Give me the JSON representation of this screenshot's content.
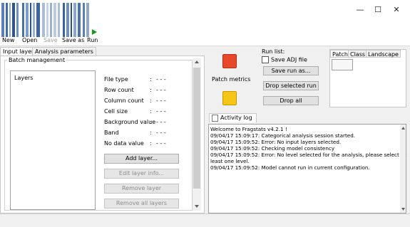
{
  "window": {
    "minimize": "—",
    "maximize": "☐",
    "close": "✕"
  },
  "toolbar": {
    "new_label": "New",
    "open_label": "Open",
    "save_label": "Save",
    "save_as_label": "Save as",
    "run_label": "Run"
  },
  "left_tabs": {
    "input_layers": "Input layers",
    "analysis_parameters": "Analysis parameters"
  },
  "batch": {
    "title": "Batch management",
    "layers_label": "Layers",
    "props": [
      {
        "label": "File type",
        "value": "- - -"
      },
      {
        "label": "Row count",
        "value": "- - -"
      },
      {
        "label": "Column count",
        "value": "- - -"
      },
      {
        "label": "Cell size",
        "value": "- - -"
      },
      {
        "label": "Background value",
        "value": "- - -"
      },
      {
        "label": "Band",
        "value": "- - -"
      },
      {
        "label": "No data value",
        "value": "- - -"
      }
    ],
    "colon": ":",
    "add_layer": "Add layer...",
    "edit_layer_info": "Edit layer info...",
    "remove_layer": "Remove layer",
    "remove_all_layers": "Remove all layers"
  },
  "metrics": {
    "patch_metrics": "Patch metrics"
  },
  "run_list": {
    "title": "Run list:",
    "save_adj": "Save ADJ file",
    "save_run_as": "Save run as...",
    "drop_selected_run": "Drop selected run",
    "drop_all": "Drop all"
  },
  "runs_tabs": {
    "patch": "Patch",
    "class": "Class",
    "landscape": "Landscape"
  },
  "log": {
    "tab_label": "Activity log",
    "lines": [
      "Welcome to Fragstats v4.2.1 !",
      "09/04/17 15:09:17: Categorical analysis session started.",
      "09/04/17 15:09:52: Error: No input layers selected.",
      "09/04/17 15:09:52: Checking model consistency",
      "09/04/17 15:09:52: Error: No level selected for the analysis, please select at",
      "least one level.",
      "09/04/17 15:09:52: Model cannot run in current configuration."
    ]
  },
  "colors": {
    "red_indicator": "#e8472a",
    "yellow_indicator": "#f5c518",
    "run_arrow": "#1a9a1a"
  }
}
